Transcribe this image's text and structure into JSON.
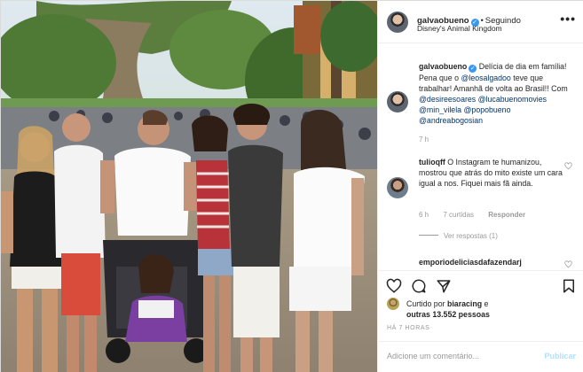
{
  "post": {
    "username": "galvaobueno",
    "following_label": "Seguindo",
    "location": "Disney's Animal Kingdom",
    "caption_parts": [
      "Delícia de dia em família! Pena que o ",
      "@leosalgadoo",
      " teve que trabalhar! Amanhã de volta ao Brasil!! Com ",
      "@desireesoares",
      " ",
      "@lucabuenomovies",
      " ",
      "@min_vilela",
      " ",
      "@popobueno",
      " ",
      "@andreabogosian"
    ],
    "caption_time": "7 h"
  },
  "comments": [
    {
      "username": "tulioqff",
      "text": "O Instagram te humanizou, mostrou que atrás do mito existe um cara igual a nos. Fiquei mais fã ainda.",
      "time": "6 h",
      "likes": "7 curtidas",
      "reply_label": "Responder",
      "view_replies": "Ver respostas (1)"
    },
    {
      "username": "emporiodeliciasdafazendarj"
    }
  ],
  "likes": {
    "prefix": "Curtido por",
    "user": "biaracing",
    "connector": "e",
    "others": "outras 13.552 pessoas"
  },
  "timestamp": "HÁ 7 HORAS",
  "add_comment": {
    "placeholder": "Adicione um comentário...",
    "publish_label": "Publicar"
  },
  "icons": {
    "like": "heart-icon",
    "comment": "comment-icon",
    "share": "share-icon",
    "save": "bookmark-icon",
    "options": "more-options-icon"
  },
  "colors": {
    "verified": "#3897f0",
    "mention": "#003569",
    "muted": "#999999",
    "publish_disabled": "#b2dffc"
  }
}
